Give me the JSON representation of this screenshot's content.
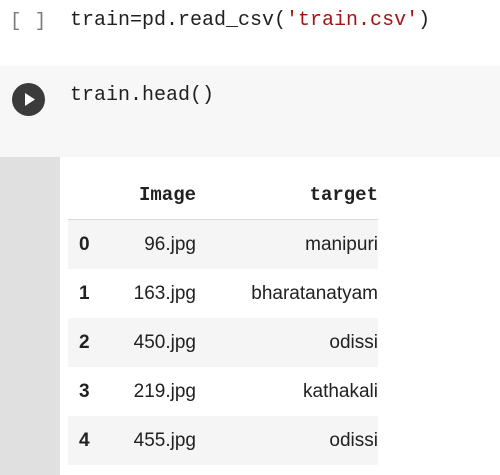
{
  "cells": [
    {
      "exec_count": "[ ]",
      "code_prefix": "train=pd.read_csv(",
      "code_string": "'train.csv'",
      "code_suffix": ")"
    },
    {
      "code": "train.head()",
      "run_icon": "play-icon"
    }
  ],
  "output": {
    "columns": [
      "",
      "Image",
      "target"
    ],
    "rows": [
      {
        "index": "0",
        "image": "96.jpg",
        "target": "manipuri"
      },
      {
        "index": "1",
        "image": "163.jpg",
        "target": "bharatanatyam"
      },
      {
        "index": "2",
        "image": "450.jpg",
        "target": "odissi"
      },
      {
        "index": "3",
        "image": "219.jpg",
        "target": "kathakali"
      },
      {
        "index": "4",
        "image": "455.jpg",
        "target": "odissi"
      }
    ]
  },
  "colors": {
    "string_literal": "#a31515",
    "code_cell_bg": "#f7f7f7",
    "output_gutter": "#e0e0e0",
    "run_button": "#3b3b3b"
  }
}
